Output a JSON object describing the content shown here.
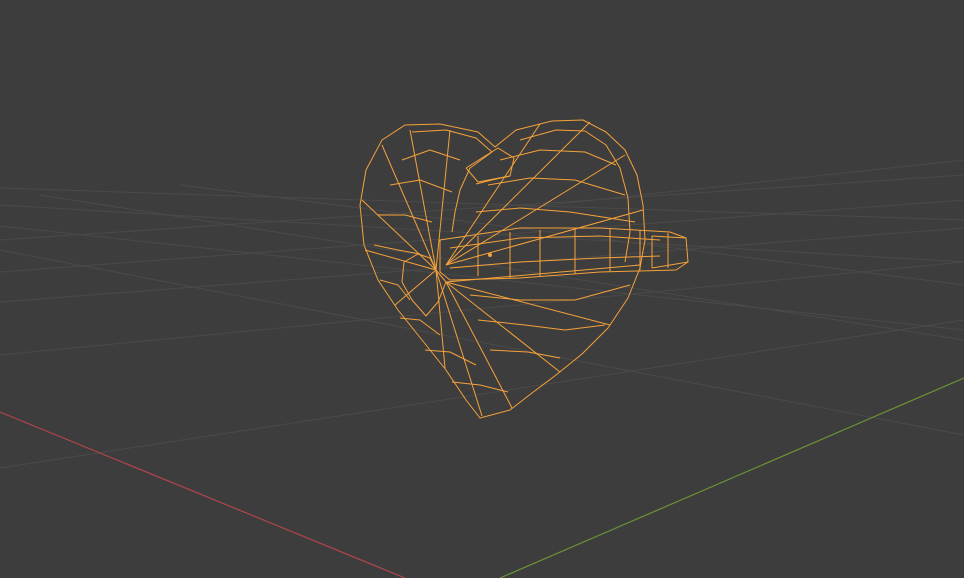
{
  "viewport": {
    "mode": "wireframe",
    "background_color": "#3d3d3d",
    "grid_color": "#4a4a4a",
    "x_axis_color": "#b2444d",
    "y_axis_color": "#6c9236"
  },
  "selected_object": {
    "shape": "heart with ring",
    "wire_color": "#f5a23b",
    "origin_color": "#f5a23b",
    "selected": true
  }
}
